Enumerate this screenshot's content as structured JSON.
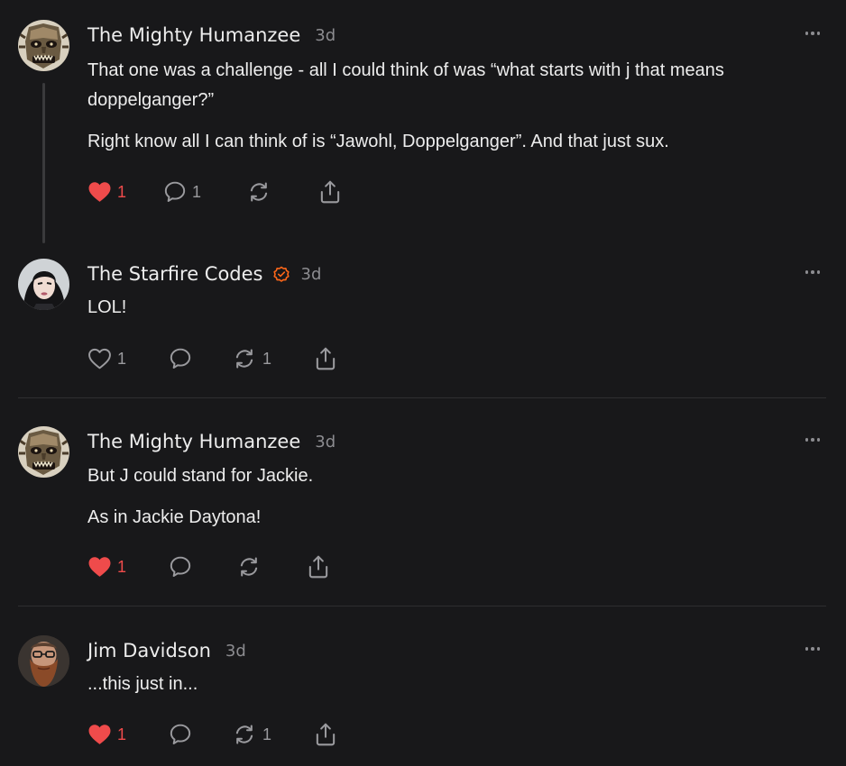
{
  "comments": [
    {
      "author": "The Mighty Humanzee",
      "time": "3d",
      "verified": false,
      "avatar_icon": "tiki-mask-avatar",
      "paragraphs": [
        "That one was a challenge - all I could think of was “what starts with j that means doppelganger?”",
        "Right know all I can think of is “Jawohl, Doppelganger”. And that just sux."
      ],
      "likes": "1",
      "liked": true,
      "replies": "1",
      "restacks": ""
    },
    {
      "author": "The Starfire Codes",
      "time": "3d",
      "verified": true,
      "avatar_icon": "woman-portrait-avatar",
      "paragraphs": [
        "LOL!"
      ],
      "likes": "1",
      "liked": false,
      "replies": "",
      "restacks": "1"
    },
    {
      "author": "The Mighty Humanzee",
      "time": "3d",
      "verified": false,
      "avatar_icon": "tiki-mask-avatar",
      "paragraphs": [
        "But J could stand for Jackie.",
        "As in Jackie Daytona!"
      ],
      "likes": "1",
      "liked": true,
      "replies": "",
      "restacks": ""
    },
    {
      "author": "Jim Davidson",
      "time": "3d",
      "verified": false,
      "avatar_icon": "bearded-man-avatar",
      "paragraphs": [
        "...this just in..."
      ],
      "likes": "1",
      "liked": true,
      "replies": "",
      "restacks": "1"
    }
  ],
  "colors": {
    "background": "#18181a",
    "text": "#ededed",
    "muted": "#8c8c90",
    "like_red": "#ef4b4b",
    "verified_orange": "#ff6719",
    "divider": "#2e2e30"
  },
  "icons": [
    "heart-icon",
    "comment-icon",
    "restack-icon",
    "share-icon",
    "more-icon",
    "verified-badge-icon"
  ]
}
